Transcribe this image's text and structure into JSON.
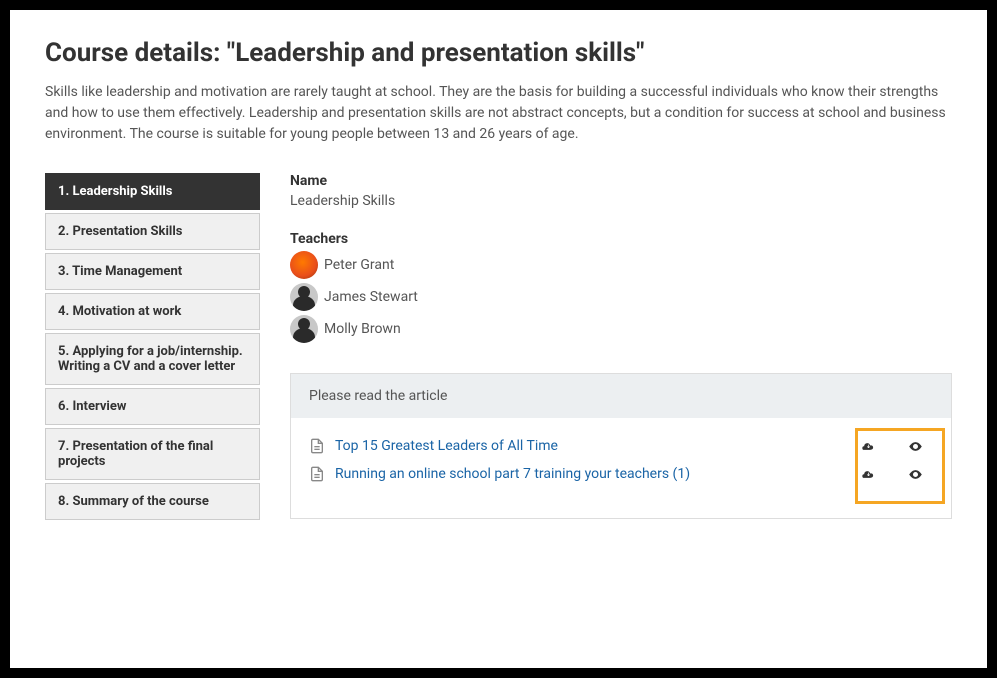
{
  "header": {
    "title": "Course details: \"Leadership and presentation skills\"",
    "intro": "Skills like leadership and motivation are rarely taught at school. They are the basis for building a successful individuals who know their strengths and how to use them effectively. Leadership and presentation skills are not abstract concepts, but a condition for success at school and business environment. The course is suitable for young people between 13 and 26 years of age."
  },
  "sidebar": {
    "items": [
      {
        "label": "1. Leadership Skills",
        "active": true
      },
      {
        "label": "2. Presentation Skills"
      },
      {
        "label": "3. Time Management"
      },
      {
        "label": "4. Motivation at work"
      },
      {
        "label": "5. Applying for a job/internship. Writing a CV and a cover letter"
      },
      {
        "label": "6. Interview"
      },
      {
        "label": "7. Presentation of the final projects"
      },
      {
        "label": "8. Summary of the course"
      }
    ]
  },
  "details": {
    "name_label": "Name",
    "name_value": "Leadership Skills",
    "teachers_label": "Teachers",
    "teachers": [
      {
        "name": "Peter Grant",
        "avatar": "orange"
      },
      {
        "name": "James Stewart",
        "avatar": "sil"
      },
      {
        "name": "Molly Brown",
        "avatar": "sil"
      }
    ]
  },
  "articles": {
    "header": "Please read the article",
    "files": [
      {
        "title": "Top 15 Greatest Leaders of All Time"
      },
      {
        "title": "Running an online school part 7 training your teachers (1)"
      }
    ]
  }
}
